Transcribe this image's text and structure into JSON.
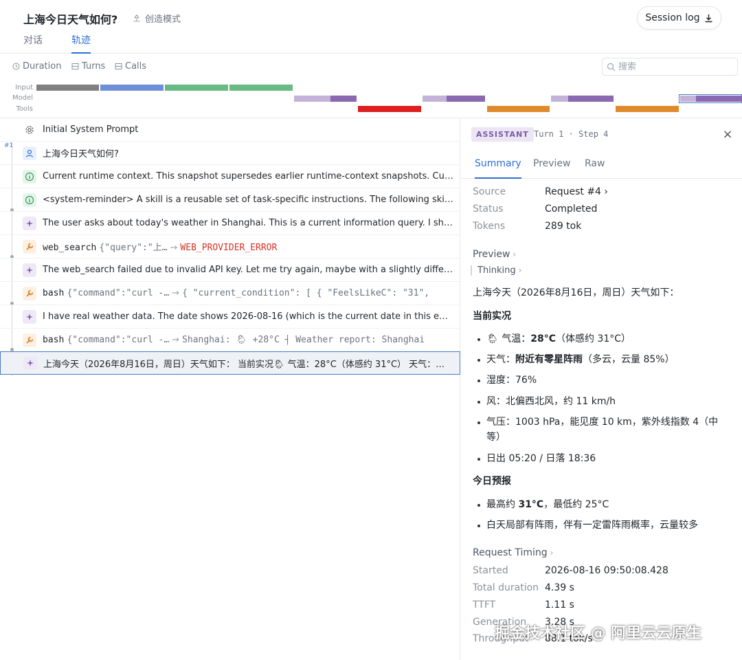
{
  "header": {
    "title": "上海今日天气如何?",
    "mode_label": "创造模式",
    "session_log_label": "Session log",
    "tabs": [
      {
        "label": "对话"
      },
      {
        "label": "轨迹"
      }
    ]
  },
  "toolbar": {
    "items": [
      {
        "label": "Duration"
      },
      {
        "label": "Turns"
      },
      {
        "label": "Calls"
      }
    ],
    "search_placeholder": "搜索"
  },
  "timeline": {
    "lanes": [
      "Input",
      "Model",
      "Tools"
    ],
    "colors": {
      "input_gray": "#808080",
      "input_blue": "#6d8fd8",
      "input_green": "#69b982",
      "model_light": "#c4b3d8",
      "model_dark": "#8a68b2",
      "tool_error": "#e02020",
      "tool_ok": "#e08a2c"
    }
  },
  "turn_badge": "#1",
  "rows": [
    {
      "kind": "system",
      "text": "Initial System Prompt"
    },
    {
      "kind": "user",
      "text": "上海今日天气如何?"
    },
    {
      "kind": "info",
      "text": "Current runtime context. This snapshot supersedes earlier runtime-context snapshots. Current date..."
    },
    {
      "kind": "info",
      "text": "<system-reminder> A skill is a reusable set of task-specific instructions. The following skills are available..."
    },
    {
      "kind": "assistant",
      "text": "The user asks about today's weather in Shanghai. This is a current information query. I should use web_search..."
    },
    {
      "kind": "tool",
      "tool": "web_search",
      "args": "{\"query\":\"上…",
      "result": "WEB_PROVIDER_ERROR",
      "is_error": true
    },
    {
      "kind": "assistant",
      "text": "The web_search failed due to invalid API key. Let me try again, maybe with a slightly different query..."
    },
    {
      "kind": "tool",
      "tool": "bash",
      "args": "{\"command\":\"curl -…",
      "result": "{ \"current_condition\": [ { \"FeelsLikeC\": \"31\",",
      "is_error": false
    },
    {
      "kind": "assistant",
      "text": "I have real weather data. The date shows 2026-08-16 (which is the current date in this environment)..."
    },
    {
      "kind": "tool",
      "tool": "bash",
      "args": "{\"command\":\"curl -…",
      "result": "Shanghai: 🌦 +28°C ┤ Weather report: Shanghai",
      "is_error": false
    },
    {
      "kind": "assistant",
      "text": "上海今天（2026年8月16日，周日）天气如下： 当前实况🌦 气温：28°C（体感约 31°C） 天气：附近有零星阵雨",
      "selected": true
    }
  ],
  "detail": {
    "role": "ASSISTANT",
    "turn_step": "Turn 1 · Step 4",
    "close": "×",
    "tabs": [
      {
        "label": "Summary"
      },
      {
        "label": "Preview"
      },
      {
        "label": "Raw"
      }
    ],
    "meta": [
      {
        "key": "Source",
        "value": "Request #4 ›"
      },
      {
        "key": "Status",
        "value": "Completed"
      },
      {
        "key": "Tokens",
        "value": "289 tok"
      }
    ],
    "preview_label": "Preview",
    "thinking_label": "Thinking",
    "intro": "上海今天（2026年8月16日，周日）天气如下：",
    "h1": "当前实况",
    "current": [
      {
        "pre": "🌦 气温：",
        "bold": "28°C",
        "post": "（体感约 31°C）"
      },
      {
        "pre": "天气：",
        "bold": "附近有零星阵雨",
        "post": "（多云，云量 85%）"
      },
      {
        "pre": "湿度：76%",
        "bold": "",
        "post": ""
      },
      {
        "pre": "风：北偏西北风，约 11 km/h",
        "bold": "",
        "post": ""
      },
      {
        "pre": "气压：1003 hPa，能见度 10 km，紫外线指数 4（中等）",
        "bold": "",
        "post": ""
      },
      {
        "pre": "日出 05:20 / 日落 18:36",
        "bold": "",
        "post": ""
      }
    ],
    "h2": "今日预报",
    "forecast": [
      {
        "pre": "最高约 ",
        "bold": "31°C",
        "post": "，最低约 25°C"
      },
      {
        "pre": "白天局部有阵雨，伴有一定雷阵雨概率，云量较多",
        "bold": "",
        "post": ""
      }
    ],
    "timing_label": "Request Timing",
    "timing": [
      {
        "key": "Started",
        "value": "2026-08-16 09:50:08.428"
      },
      {
        "key": "Total duration",
        "value": "4.39 s"
      },
      {
        "key": "TTFT",
        "value": "1.11 s"
      },
      {
        "key": "Generation",
        "value": "3.28 s"
      },
      {
        "key": "Throughput",
        "value": "88.1 tok/s"
      }
    ]
  },
  "watermark": "掘金技术社区 @ 阿里云云原生"
}
